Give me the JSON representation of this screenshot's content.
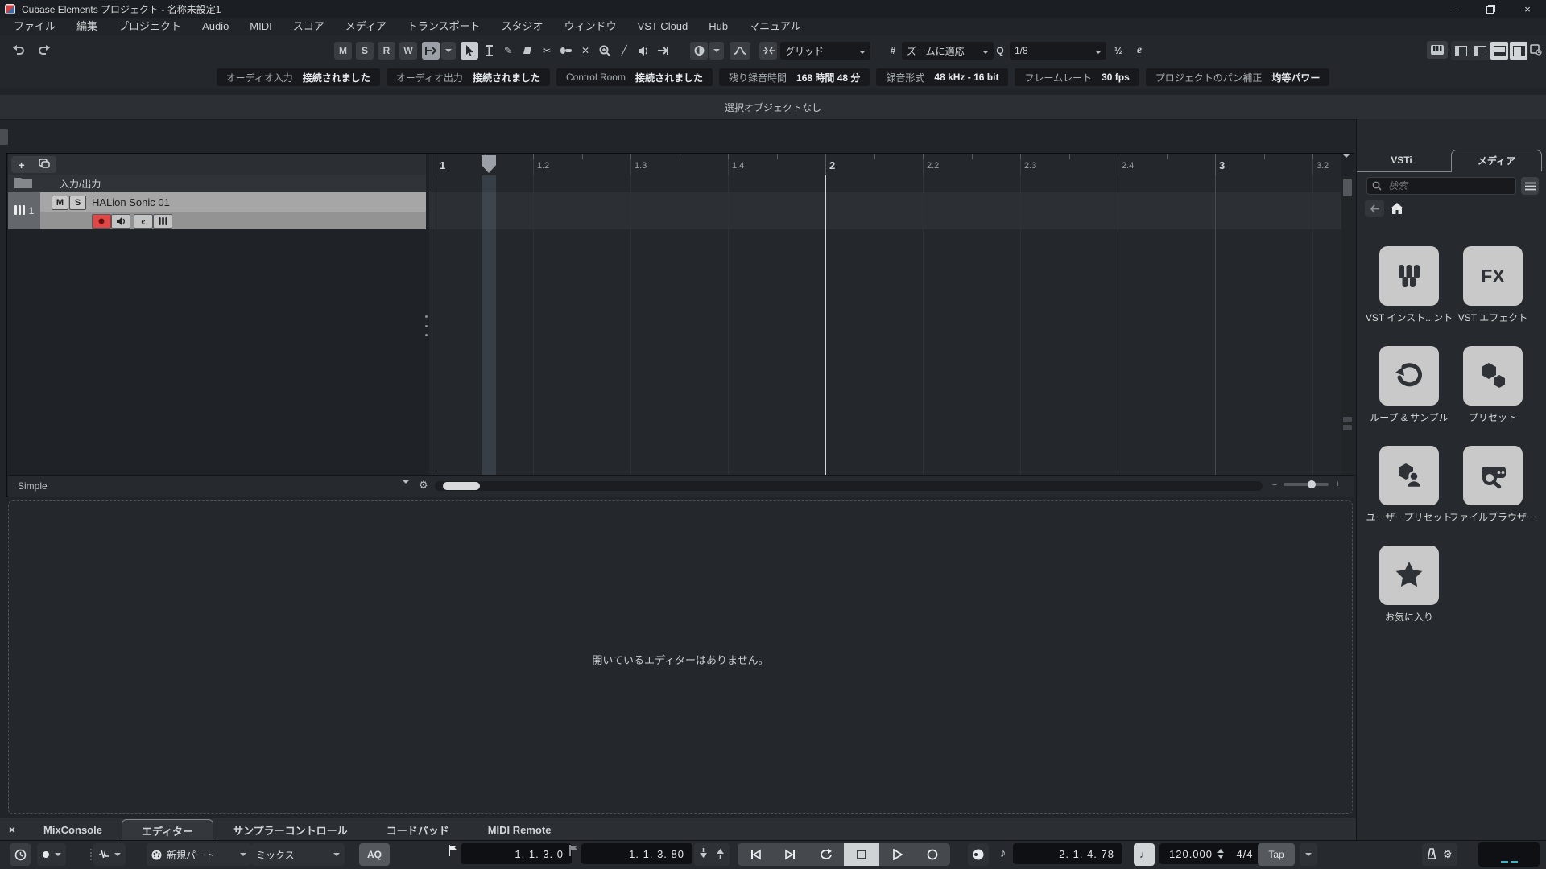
{
  "window": {
    "title": "Cubase Elements プロジェクト - 名称未設定1"
  },
  "icons": {
    "minimize": "–",
    "close": "×",
    "dropdown": "▼",
    "plus": "+",
    "note": "♪",
    "quarter_note": "♩",
    "gear": "⚙",
    "hash": "#",
    "list": "≡",
    "scissors": "✂",
    "pencil": "✎",
    "mute_x": "✕",
    "line": "╱",
    "left_chevron": "←"
  },
  "menubar": {
    "items": [
      "ファイル",
      "編集",
      "プロジェクト",
      "Audio",
      "MIDI",
      "スコア",
      "メディア",
      "トランスポート",
      "スタジオ",
      "ウィンドウ",
      "VST Cloud",
      "Hub",
      "マニュアル"
    ]
  },
  "toolbar": {
    "automation": [
      "M",
      "S",
      "R",
      "W"
    ],
    "grid_mode": "グリッド",
    "zoom_mode": "ズームに適応",
    "quantize_icon_label": "Q",
    "quantize_value": "1/8",
    "iq_label": "½",
    "edit_label": "e"
  },
  "infobar": {
    "items": [
      {
        "label": "オーディオ入力",
        "value": "接続されました"
      },
      {
        "label": "オーディオ出力",
        "value": "接続されました"
      },
      {
        "label": "Control Room",
        "value": "接続されました"
      },
      {
        "label": "残り録音時間",
        "value": "168 時間 48 分"
      },
      {
        "label": "録音形式",
        "value": "48 kHz - 16 bit"
      },
      {
        "label": "フレームレート",
        "value": "30 fps"
      },
      {
        "label": "プロジェクトのパン補正",
        "value": "均等パワー"
      }
    ]
  },
  "statusline": {
    "text": "選択オブジェクトなし"
  },
  "project": {
    "io_label": "入力/出力",
    "track": {
      "number": "1",
      "name": "HALion Sonic 01",
      "mute": "M",
      "solo": "S",
      "edit": "e"
    },
    "ruler_labels": [
      "1",
      "1.2",
      "1.3",
      "1.4",
      "2",
      "2.2",
      "2.3",
      "2.4",
      "3",
      "3.2"
    ],
    "footer_label": "Simple"
  },
  "lower_zone": {
    "empty_text": "開いているエディターはありません。",
    "tabs": [
      {
        "label": "MixConsole",
        "active": false
      },
      {
        "label": "エディター",
        "active": true
      },
      {
        "label": "サンプラーコントロール",
        "active": false
      },
      {
        "label": "コードパッド",
        "active": false
      },
      {
        "label": "MIDI Remote",
        "active": false
      }
    ]
  },
  "transport": {
    "left_locator": "1. 1. 3.   0",
    "right_locator": "1. 1. 3. 80",
    "part_mode": "新規パート",
    "mix_mode": "ミックス",
    "aq_label": "AQ",
    "secondary_time": "2. 1. 4. 78",
    "tempo": "120.000",
    "time_signature": "4/4",
    "tap_label": "Tap"
  },
  "right_zone": {
    "tab_vsti": "VSTi",
    "tab_media": "メディア",
    "search_placeholder": "検索",
    "tiles": [
      {
        "label": "VST インスト...ント",
        "icon": "piano"
      },
      {
        "label": "VST エフェクト",
        "icon": "fx",
        "icon_text": "FX"
      },
      {
        "label": "ループ & サンプル",
        "icon": "loop"
      },
      {
        "label": "プリセット",
        "icon": "hexagons"
      },
      {
        "label": "ユーザープリセット",
        "icon": "user-preset"
      },
      {
        "label": "ファイルブラウザー",
        "icon": "file-browser"
      },
      {
        "label": "お気に入り",
        "icon": "star"
      }
    ]
  }
}
